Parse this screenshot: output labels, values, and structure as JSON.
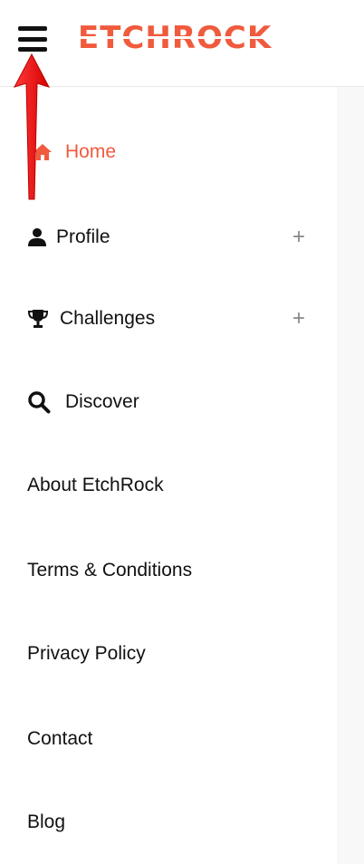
{
  "header": {
    "logo_text": "ETCHROCK",
    "brand_color": "#f05a3d"
  },
  "menu": {
    "items": [
      {
        "label": "Home",
        "icon": "home-icon",
        "active": true
      },
      {
        "label": "Profile",
        "icon": "user-icon",
        "expand": "+"
      },
      {
        "label": "Challenges",
        "icon": "trophy-icon",
        "expand": "+"
      },
      {
        "label": "Discover",
        "icon": "search-icon"
      },
      {
        "label": "About EtchRock"
      },
      {
        "label": "Terms & Conditions"
      },
      {
        "label": "Privacy Policy"
      },
      {
        "label": "Contact"
      },
      {
        "label": "Blog"
      }
    ]
  },
  "annotation": {
    "color": "#ff1a1a"
  }
}
